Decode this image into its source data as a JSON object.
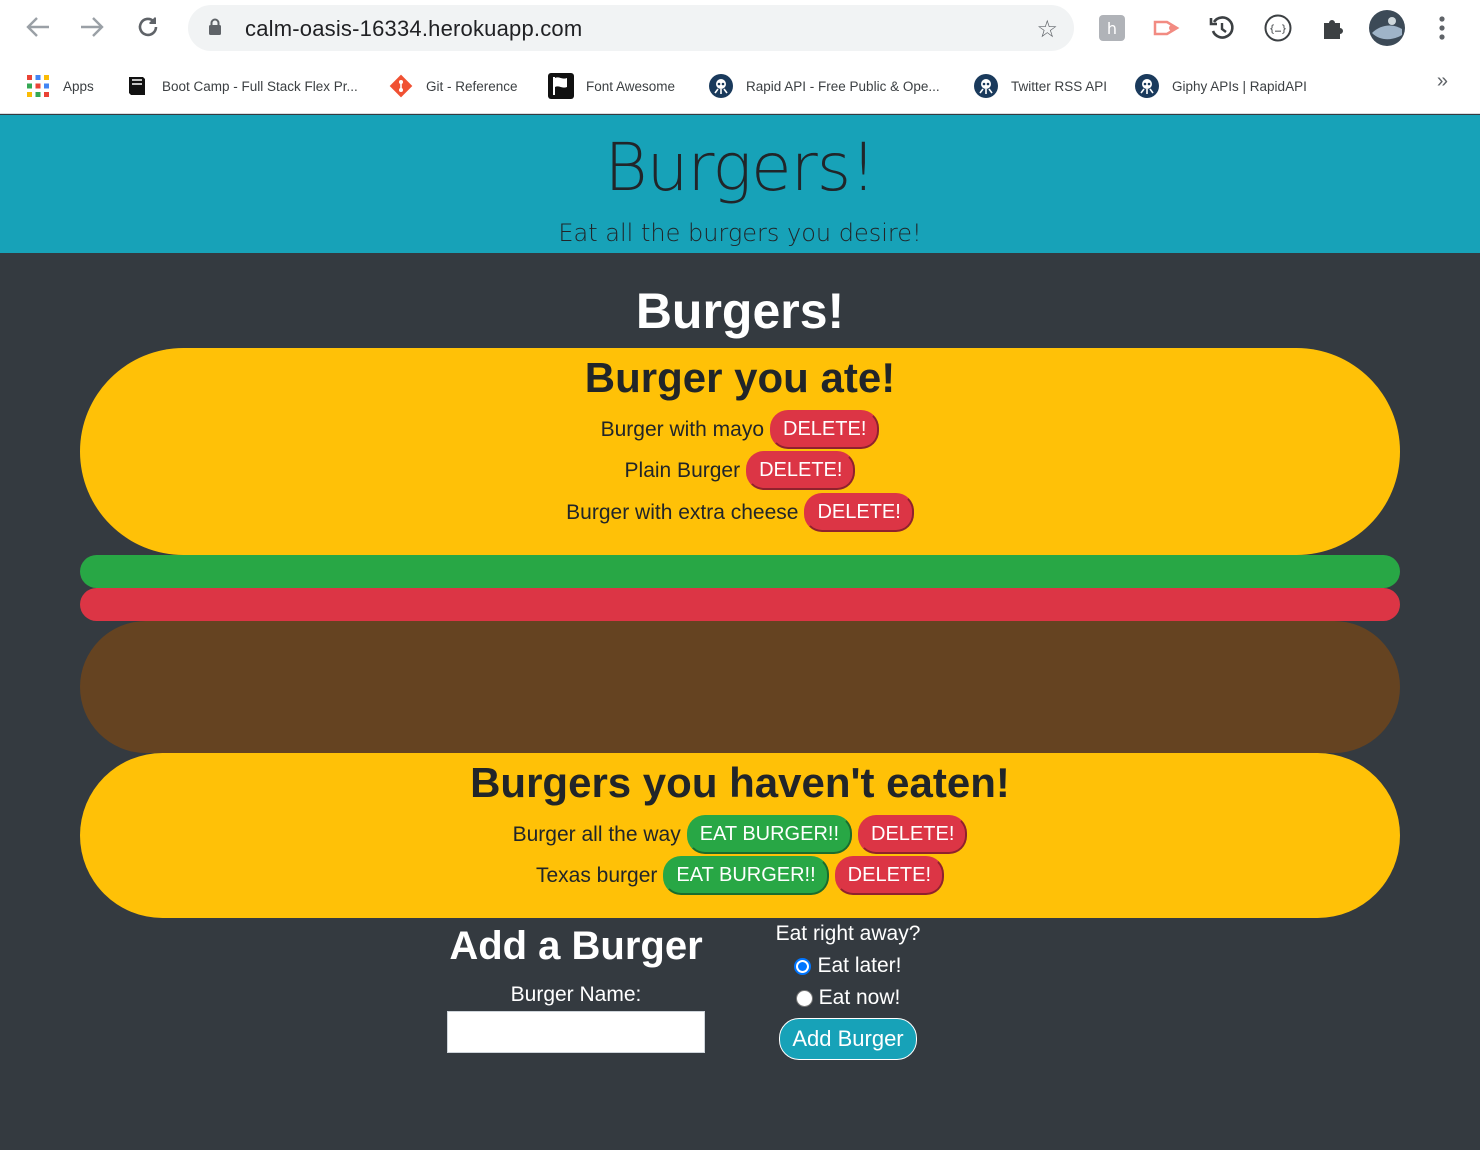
{
  "browser": {
    "url": "calm-oasis-16334.herokuapp.com",
    "bookmarks": [
      {
        "label": "Apps",
        "icon": "apps-grid-icon"
      },
      {
        "label": "Boot Camp - Full Stack Flex Pr...",
        "icon": "book-icon"
      },
      {
        "label": "Git - Reference",
        "icon": "git-icon"
      },
      {
        "label": "Font Awesome",
        "icon": "flag-icon"
      },
      {
        "label": "Rapid API - Free Public & Ope...",
        "icon": "rapidapi-icon"
      },
      {
        "label": "Twitter RSS API",
        "icon": "rapidapi-icon"
      },
      {
        "label": "Giphy APIs | RapidAPI",
        "icon": "rapidapi-icon"
      }
    ],
    "more_label": "»"
  },
  "header": {
    "title": "Burgers!",
    "subtitle": "Eat all the burgers you desire!"
  },
  "main": {
    "title": "Burgers!"
  },
  "eaten": {
    "title": "Burger you ate!",
    "items": [
      {
        "name": "Burger with mayo",
        "delete_label": "DELETE!"
      },
      {
        "name": "Plain Burger",
        "delete_label": "DELETE!"
      },
      {
        "name": "Burger with extra cheese",
        "delete_label": "DELETE!"
      }
    ]
  },
  "not_eaten": {
    "title": "Burgers you haven't eaten!",
    "items": [
      {
        "name": "Burger all the way",
        "eat_label": "EAT BURGER!!",
        "delete_label": "DELETE!"
      },
      {
        "name": "Texas burger",
        "eat_label": "EAT BURGER!!",
        "delete_label": "DELETE!"
      }
    ]
  },
  "form": {
    "title": "Add a Burger",
    "name_label": "Burger Name:",
    "name_value": "",
    "question": "Eat right away?",
    "options": [
      {
        "label": "Eat later!",
        "checked": true
      },
      {
        "label": "Eat now!",
        "checked": false
      }
    ],
    "submit_label": "Add Burger"
  },
  "colors": {
    "jumbotron": "#17a2b8",
    "page_bg": "#343a40",
    "bun": "#ffc107",
    "lettuce": "#28a745",
    "tomato": "#dc3545",
    "patty": "#654321"
  }
}
